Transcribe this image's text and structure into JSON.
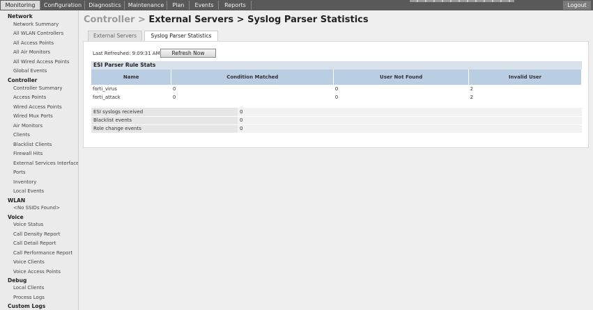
{
  "topbar": {
    "tabs": [
      "Monitoring",
      "Configuration",
      "Diagnostics",
      "Maintenance",
      "Plan",
      "Events",
      "Reports"
    ],
    "active_tab": "Monitoring",
    "logout": "Logout"
  },
  "sidebar": {
    "sections": [
      {
        "title": "Network",
        "items": [
          "Network Summary",
          "All WLAN Controllers",
          "All Access Points",
          "All Air Monitors",
          "All Wired Access Points",
          "Global Events"
        ]
      },
      {
        "title": "Controller",
        "items": [
          "Controller Summary",
          "Access Points",
          "Wired Access Points",
          "Wired Mux Ports",
          "Air Monitors",
          "Clients",
          "Blacklist Clients",
          "Firewall Hits",
          "External Services Interface",
          "Ports",
          "Inventory",
          "Local Events"
        ]
      },
      {
        "title": "WLAN",
        "items": [
          "<No SSIDs Found>"
        ]
      },
      {
        "title": "Voice",
        "items": [
          "Voice Status",
          "Call Density Report",
          "Call Detail Report",
          "Call Performance Report",
          "Voice Clients",
          "Voice Access Points"
        ]
      },
      {
        "title": "Debug",
        "items": [
          "Local Clients",
          "Process Logs"
        ]
      },
      {
        "title": "Custom Logs",
        "items": []
      }
    ]
  },
  "main": {
    "breadcrumb": {
      "root": "Controller",
      "sep": ">",
      "path": "External Servers > Syslog Parser Statistics"
    },
    "tabs": [
      {
        "label": "External Servers",
        "active": false
      },
      {
        "label": "Syslog Parser Statistics",
        "active": true
      }
    ],
    "last_refreshed_label": "Last Refreshed: 9:09:31 AM",
    "refresh_button": "Refresh Now",
    "section_title": "ESI Parser Rule Stats",
    "table": {
      "headers": [
        "Name",
        "Condition Matched",
        "User Not Found",
        "Invalid User"
      ],
      "rows": [
        [
          "forti_virus",
          "0",
          "0",
          "2"
        ],
        [
          "forti_attack",
          "0",
          "0",
          "2"
        ]
      ]
    },
    "summary": [
      {
        "label": "ESI syslogs received",
        "value": "0"
      },
      {
        "label": "Blacklist events",
        "value": "0"
      },
      {
        "label": "Role change events",
        "value": "0"
      }
    ]
  }
}
